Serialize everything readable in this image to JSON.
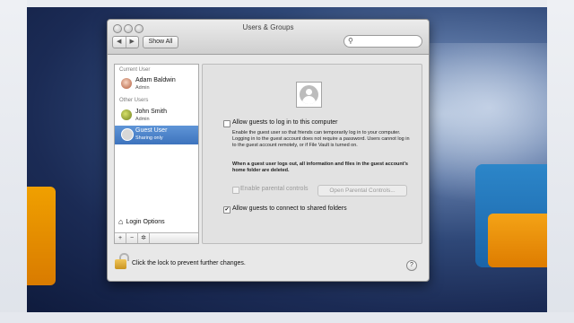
{
  "window": {
    "title": "Users & Groups",
    "nav_back": "◀",
    "nav_forward": "▶",
    "show_all": "Show All",
    "search_placeholder": ""
  },
  "sidebar": {
    "current_user_header": "Current User",
    "other_users_header": "Other Users",
    "users": [
      {
        "name": "Adam Baldwin",
        "role": "Admin"
      },
      {
        "name": "John Smith",
        "role": "Admin"
      },
      {
        "name": "Guest User",
        "role": "Sharing only"
      }
    ],
    "login_options": "Login Options",
    "add": "+",
    "remove": "−",
    "action": "✲"
  },
  "content": {
    "allow_login_label": "Allow guests to log in to this computer",
    "allow_login_checked": false,
    "description": "Enable the guest user so that friends can temporarily log in to your computer. Logging in to the guest account does not require a password. Users cannot log in to the guest account remotely, or if File Vault is turned on.",
    "bold_note": "When a guest user logs out, all information and files in the guest account's home folder are deleted.",
    "parental_label": "Enable parental controls",
    "parental_button": "Open Parental Controls...",
    "shared_label": "Allow guests to connect to shared folders",
    "shared_checked": true
  },
  "footer": {
    "lock_text": "Click the lock to prevent further changes.",
    "help": "?"
  }
}
